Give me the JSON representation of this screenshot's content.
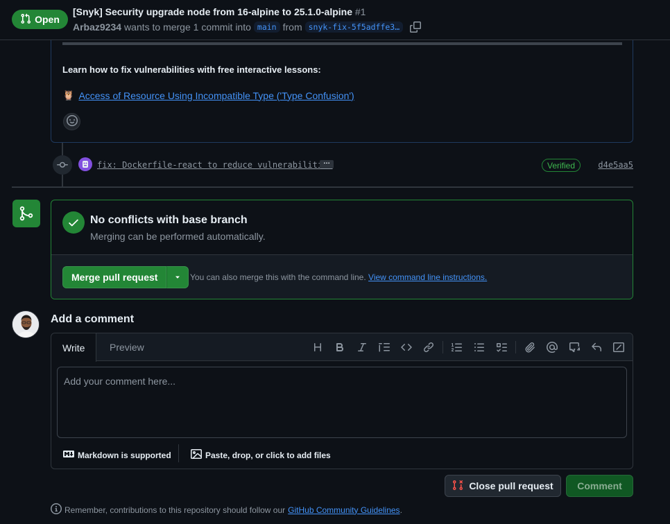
{
  "header": {
    "state": "Open",
    "title": "[Snyk] Security upgrade node from 16-alpine to 25.1.0-alpine",
    "number": "#1",
    "author": "Arbaz9234",
    "meta_text": "wants to merge 1 commit into",
    "base_branch": "main",
    "from_text": "from",
    "head_branch": "snyk-fix-5f5adffe3…"
  },
  "top_comment": {
    "learn_text": "Learn how to fix vulnerabilities with free interactive lessons:",
    "lesson_emoji": "🦉",
    "lesson_link": "Access of Resource Using Incompatible Type ('Type Confusion')"
  },
  "commit": {
    "message": "fix: Dockerfile-react to reduce vulnerabilities",
    "ellipsis": "…",
    "verified_label": "Verified",
    "sha": "d4e5aa5"
  },
  "merge_box": {
    "status_title": "No conflicts with base branch",
    "status_subtitle": "Merging can be performed automatically.",
    "merge_button": "Merge pull request",
    "hint_text": "You can also merge this with the command line.",
    "hint_link": "View command line instructions."
  },
  "comment_form": {
    "heading": "Add a comment",
    "tab_write": "Write",
    "tab_preview": "Preview",
    "placeholder": "Add your comment here...",
    "markdown_label": "Markdown is supported",
    "attach_label": "Paste, drop, or click to add files",
    "close_button": "Close pull request",
    "comment_button": "Comment"
  },
  "footer": {
    "text": "Remember, contributions to this repository should follow our",
    "link": "GitHub Community Guidelines",
    "period": "."
  },
  "colors": {
    "background": "#0d1117",
    "accent_green": "#238636",
    "link_blue": "#4493f8",
    "muted_text": "#8d96a0",
    "border": "#30363d"
  }
}
